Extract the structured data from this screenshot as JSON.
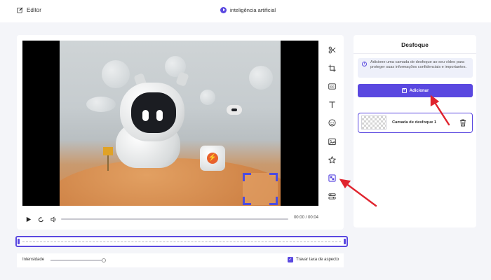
{
  "header": {
    "editor_label": "Editor",
    "project_name": "inteligência artificial"
  },
  "toolbar": {
    "tools": [
      "cut-icon",
      "crop-icon",
      "subtitles-icon",
      "text-icon",
      "sticker-icon",
      "image-icon",
      "star-icon",
      "blur-icon",
      "layers-icon"
    ]
  },
  "player": {
    "time": "00:00 / 00:04",
    "progress": 0
  },
  "bottom": {
    "intensity_label": "Intensidade",
    "intensity_value": 0.97,
    "aspect_label": "Travar taxa de aspecto",
    "aspect_checked": true
  },
  "panel": {
    "title": "Desfoque",
    "info_text": "Adicione uma camada de desfoque ao seu vídeo para proteger suas informações confidenciais e importantes.",
    "add_button": "Adicionar",
    "layer_name": "Camada de desfoque 1"
  },
  "colors": {
    "accent": "#5a48e0",
    "annotation_arrow": "#e0242e"
  }
}
